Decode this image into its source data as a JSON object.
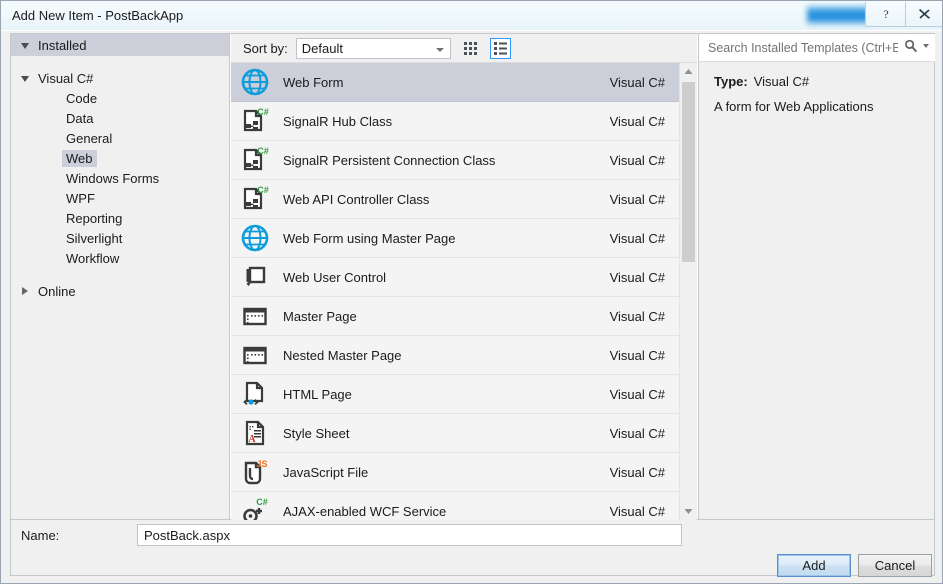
{
  "window": {
    "title": "Add New Item - PostBackApp",
    "help_icon": "help-icon",
    "close_icon": "close-icon",
    "blurred_region": "blurred-badge"
  },
  "tree": {
    "header": {
      "label": "Installed",
      "expander": "chevron-down-icon"
    },
    "groups": [
      {
        "label": "Visual C#",
        "expander": "chevron-down-icon",
        "items": [
          {
            "label": "Code",
            "selected": false
          },
          {
            "label": "Data",
            "selected": false
          },
          {
            "label": "General",
            "selected": false
          },
          {
            "label": "Web",
            "selected": true
          },
          {
            "label": "Windows Forms",
            "selected": false
          },
          {
            "label": "WPF",
            "selected": false
          },
          {
            "label": "Reporting",
            "selected": false
          },
          {
            "label": "Silverlight",
            "selected": false
          },
          {
            "label": "Workflow",
            "selected": false
          }
        ]
      }
    ],
    "online": {
      "label": "Online",
      "expander": "chevron-right-icon"
    }
  },
  "toolbar": {
    "sort_by_label": "Sort by:",
    "sort_by_value": "Default",
    "view_medium_icons": "medium-icons-view-icon",
    "view_list": "list-view-icon",
    "view_list_active": true
  },
  "search": {
    "placeholder": "Search Installed Templates (Ctrl+E)",
    "value": "",
    "icon": "search-icon",
    "dropdown": "chevron-down-icon"
  },
  "templates": [
    {
      "name": "Web Form",
      "language": "Visual C#",
      "icon": "globe-icon",
      "selected": true
    },
    {
      "name": "SignalR Hub Class",
      "language": "Visual C#",
      "icon": "csharp-class-icon",
      "selected": false
    },
    {
      "name": "SignalR Persistent Connection Class",
      "language": "Visual C#",
      "icon": "csharp-class-icon",
      "selected": false
    },
    {
      "name": "Web API Controller Class",
      "language": "Visual C#",
      "icon": "csharp-class-icon",
      "selected": false
    },
    {
      "name": "Web Form using Master Page",
      "language": "Visual C#",
      "icon": "globe-icon",
      "selected": false
    },
    {
      "name": "Web User Control",
      "language": "Visual C#",
      "icon": "user-control-icon",
      "selected": false
    },
    {
      "name": "Master Page",
      "language": "Visual C#",
      "icon": "master-page-icon",
      "selected": false
    },
    {
      "name": "Nested Master Page",
      "language": "Visual C#",
      "icon": "master-page-icon",
      "selected": false
    },
    {
      "name": "HTML Page",
      "language": "Visual C#",
      "icon": "html-page-icon",
      "selected": false
    },
    {
      "name": "Style Sheet",
      "language": "Visual C#",
      "icon": "style-sheet-icon",
      "selected": false
    },
    {
      "name": "JavaScript File",
      "language": "Visual C#",
      "icon": "javascript-file-icon",
      "selected": false
    },
    {
      "name": "AJAX-enabled WCF Service",
      "language": "Visual C#",
      "icon": "wcf-service-icon",
      "selected": false
    }
  ],
  "details": {
    "type_label": "Type:",
    "type_value": "Visual C#",
    "description": "A form for Web Applications"
  },
  "name_field": {
    "label": "Name:",
    "value": "PostBack.aspx"
  },
  "buttons": {
    "add": "Add",
    "cancel": "Cancel"
  },
  "colors": {
    "selection": "#ccced9",
    "accent_blue": "#3399ff",
    "icon_blue": "#0d9ddb",
    "csharp_green": "#2e9b3c",
    "js_orange": "#f2711c",
    "dialog_bg": "#f0f0f0"
  }
}
